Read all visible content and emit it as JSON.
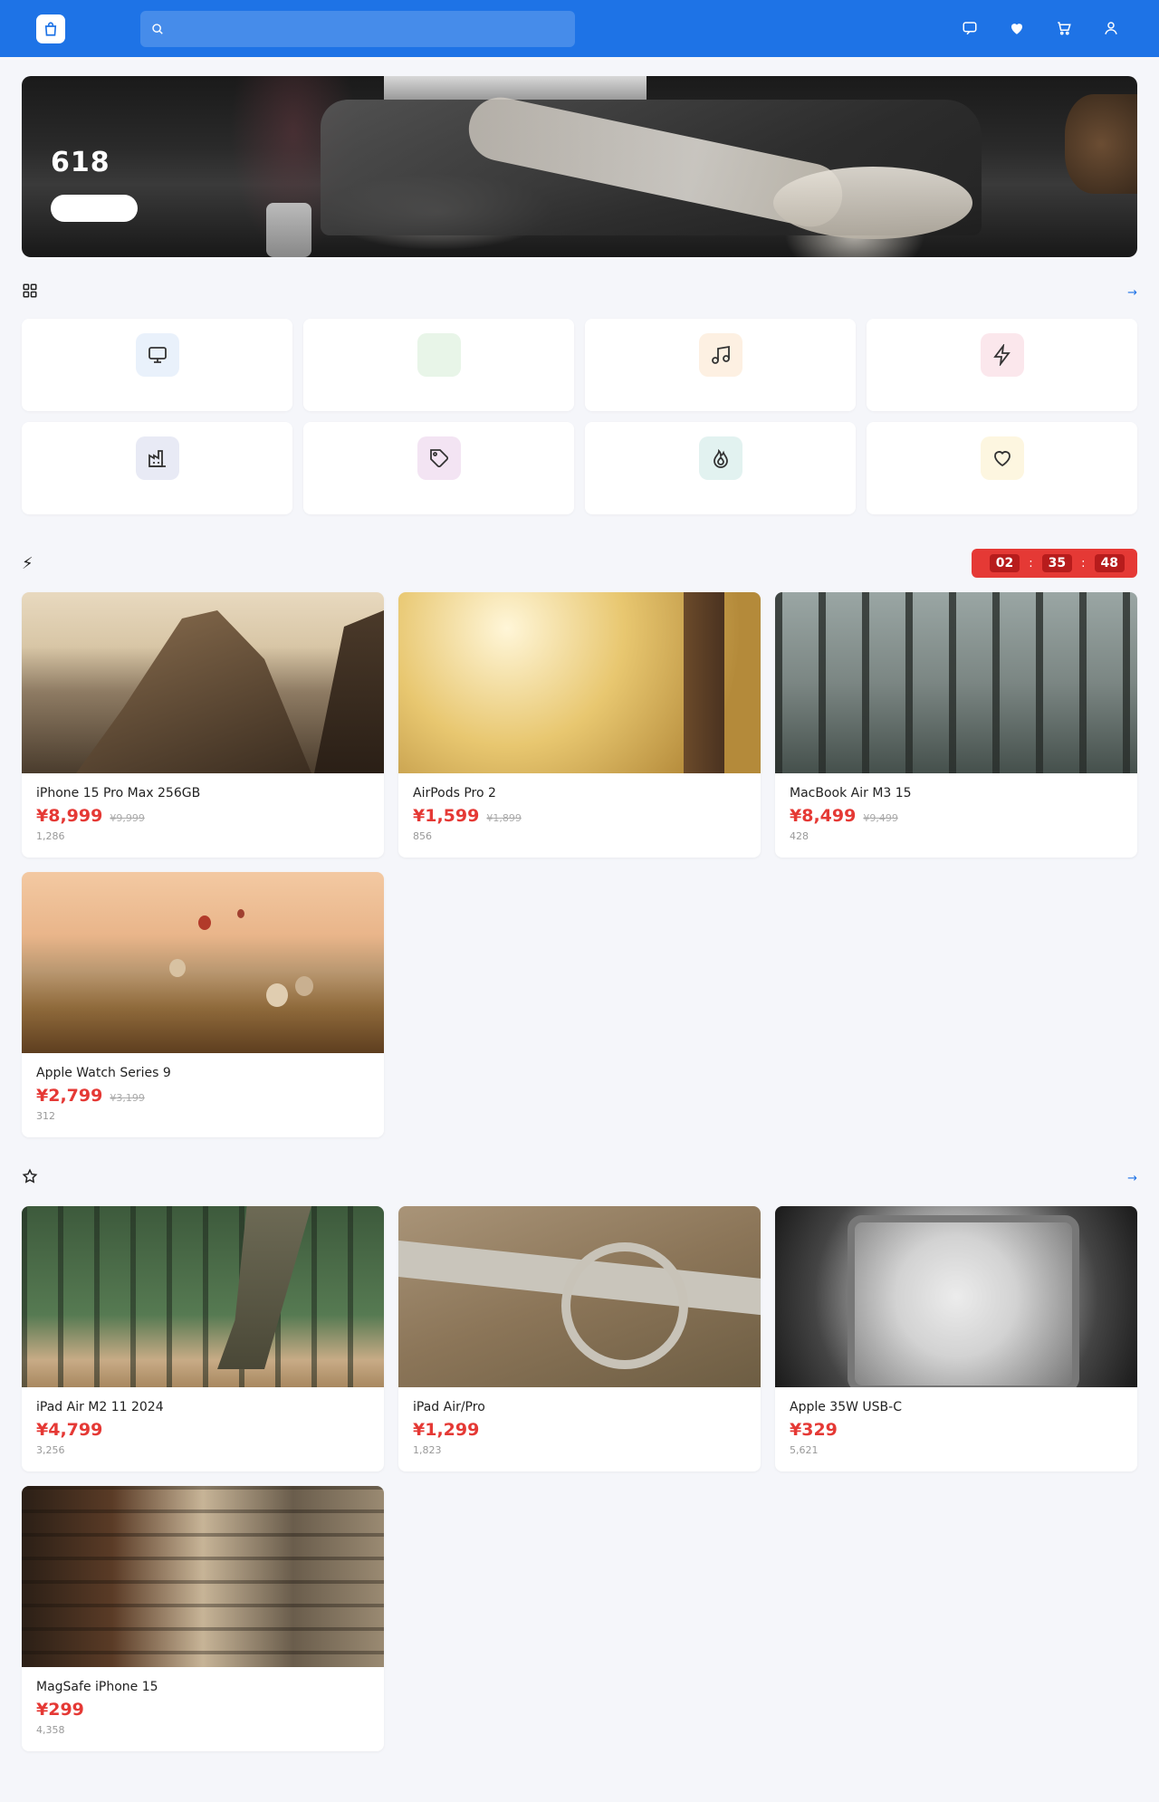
{
  "header": {
    "logo_icon": "bag-icon",
    "brand_name": "",
    "search_placeholder": "",
    "icons": [
      "message-icon",
      "heart-icon",
      "cart-icon",
      "user-icon"
    ]
  },
  "banner": {
    "title": "618",
    "subtitle": "",
    "button_label": ""
  },
  "categories": {
    "title": "",
    "more_label": "",
    "items": [
      {
        "label": "",
        "icon": "monitor-icon",
        "bg": "#e9f1fb"
      },
      {
        "label": "",
        "icon": "blank-icon",
        "bg": "#e8f5e8"
      },
      {
        "label": "",
        "icon": "music-icon",
        "bg": "#fdf0e2"
      },
      {
        "label": "",
        "icon": "lightning-icon",
        "bg": "#fbe7ec"
      },
      {
        "label": "",
        "icon": "factory-icon",
        "bg": "#e8eaf5"
      },
      {
        "label": "",
        "icon": "tag-icon",
        "bg": "#f3e4f3"
      },
      {
        "label": "",
        "icon": "flame-icon",
        "bg": "#e2f2f0"
      },
      {
        "label": "",
        "icon": "heart-outline-icon",
        "bg": "#fdf6e0"
      }
    ]
  },
  "flash_sale": {
    "title_glyph": "⚡",
    "title": "",
    "countdown_label": "",
    "hours": "02",
    "minutes": "35",
    "seconds": "48",
    "products": [
      {
        "name": "iPhone 15 Pro Max 256GB",
        "price": "¥8,999",
        "original": "¥9,999",
        "sold": "1,286"
      },
      {
        "name": "AirPods Pro 2",
        "price": "¥1,599",
        "original": "¥1,899",
        "sold": "856"
      },
      {
        "name": "MacBook Air M3 15",
        "price": "¥8,499",
        "original": "¥9,499",
        "sold": "428"
      },
      {
        "name": "Apple Watch Series 9",
        "price": "¥2,799",
        "original": "¥3,199",
        "sold": "312"
      }
    ]
  },
  "recommended": {
    "title": "",
    "more_label": "",
    "products": [
      {
        "name": "iPad Air M2 11 2024",
        "price": "¥4,799",
        "sold": "3,256"
      },
      {
        "name": "iPad Air/Pro",
        "price": "¥1,299",
        "sold": "1,823"
      },
      {
        "name": "Apple 35W USB-C",
        "price": "¥329",
        "sold": "5,621"
      },
      {
        "name": "MagSafe iPhone 15",
        "price": "¥299",
        "sold": "4,358"
      }
    ]
  },
  "colors": {
    "primary": "#1e73e6",
    "price": "#e53935",
    "background": "#f5f6fa"
  }
}
